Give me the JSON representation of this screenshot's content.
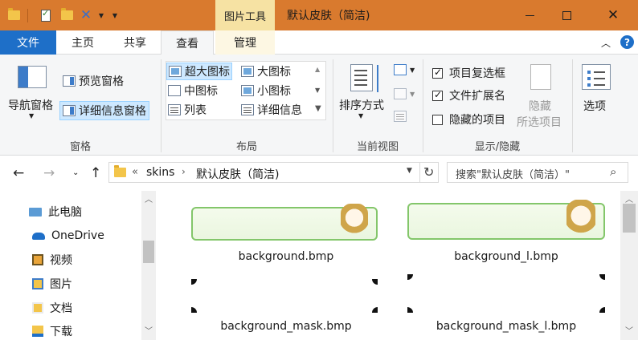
{
  "window": {
    "title": "默认皮肤（简洁)",
    "context_tab": "图片工具",
    "colors": {
      "titlebar": "#d97a2e",
      "file_tab": "#1e6fc8",
      "context_tab": "#f6e2a3",
      "selected": "#cde8ff"
    }
  },
  "tabs": {
    "file": "文件",
    "home": "主页",
    "share": "共享",
    "view": "查看",
    "manage": "管理"
  },
  "ribbon": {
    "pane_group": {
      "label": "窗格",
      "nav_pane": "导航窗格",
      "preview_pane": "预览窗格",
      "details_pane": "详细信息窗格"
    },
    "layout_group": {
      "label": "布局",
      "items": [
        "超大图标",
        "大图标",
        "中图标",
        "小图标",
        "列表",
        "详细信息"
      ],
      "selected": "超大图标"
    },
    "current_view_group": {
      "label": "当前视图",
      "sort_by": "排序方式"
    },
    "show_hide_group": {
      "label": "显示/隐藏",
      "item_checkboxes": {
        "label": "项目复选框",
        "checked": true
      },
      "file_extensions": {
        "label": "文件扩展名",
        "checked": true
      },
      "hidden_items": {
        "label": "隐藏的项目",
        "checked": false
      },
      "hide_selected_line1": "隐藏",
      "hide_selected_line2": "所选项目"
    },
    "options": "选项"
  },
  "address": {
    "prefix": "«",
    "path": [
      "skins",
      "默认皮肤（简洁)"
    ]
  },
  "search": {
    "placeholder": "搜索\"默认皮肤（简洁）\""
  },
  "nav_pane": {
    "items": [
      "此电脑",
      "OneDrive",
      "视频",
      "图片",
      "文档",
      "下载"
    ]
  },
  "files": [
    {
      "name": "background.bmp"
    },
    {
      "name": "background_l.bmp"
    },
    {
      "name": "background_mask.bmp"
    },
    {
      "name": "background_mask_l.bmp"
    }
  ]
}
